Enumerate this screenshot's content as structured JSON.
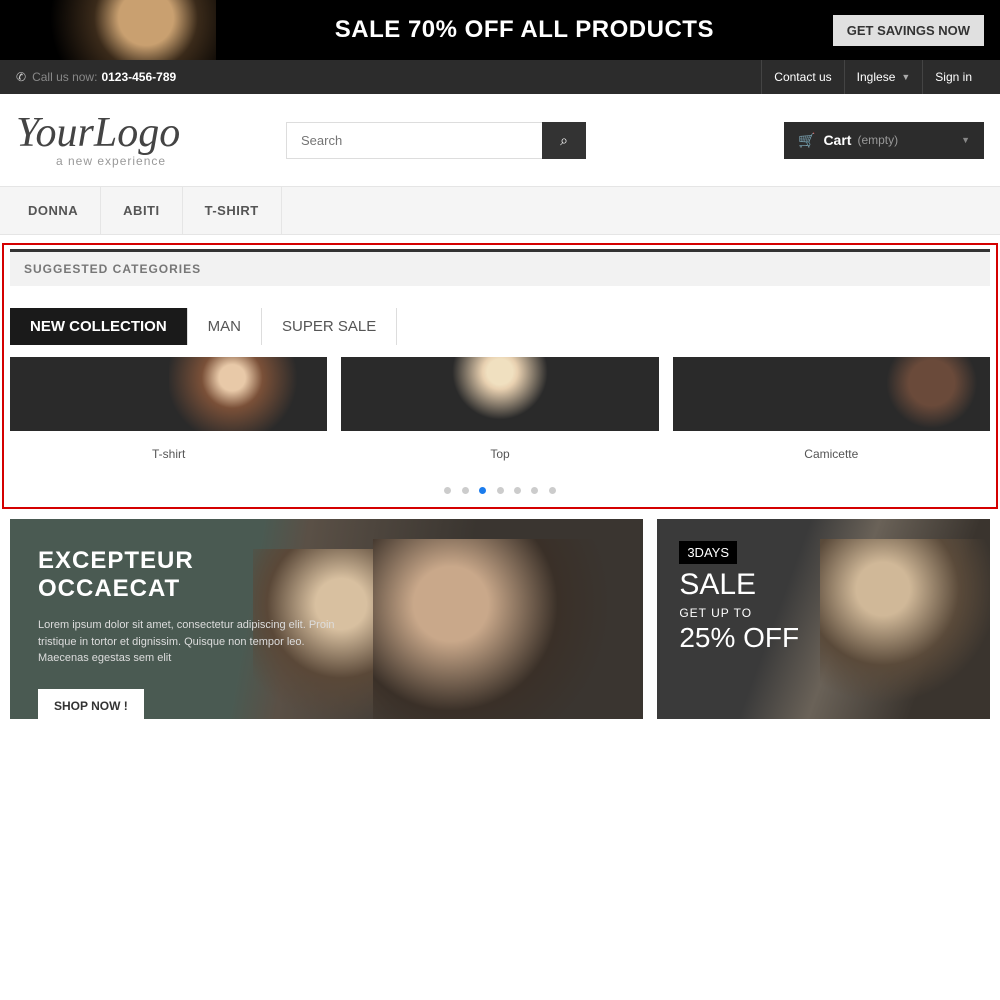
{
  "banner": {
    "headline": "SALE 70% OFF ALL PRODUCTS",
    "cta": "GET SAVINGS NOW"
  },
  "topnav": {
    "call_label": "Call us now:",
    "phone": "0123-456-789",
    "contact": "Contact us",
    "language": "Inglese",
    "signin": "Sign in"
  },
  "logo": {
    "main": "YourLogo",
    "sub": "a new experience"
  },
  "search": {
    "placeholder": "Search"
  },
  "cart": {
    "label": "Cart",
    "status": "(empty)"
  },
  "mainnav": {
    "items": [
      "DONNA",
      "ABITI",
      "T-SHIRT"
    ]
  },
  "suggested": {
    "title": "SUGGESTED CATEGORIES",
    "tabs": [
      "NEW COLLECTION",
      "MAN",
      "SUPER SALE"
    ],
    "active_tab": 0,
    "items": [
      {
        "label": "T-shirt"
      },
      {
        "label": "Top"
      },
      {
        "label": "Camicette"
      }
    ],
    "dot_count": 7,
    "active_dot": 2
  },
  "promo_left": {
    "title1": "EXCEPTEUR",
    "title2": "OCCAECAT",
    "text": "Lorem ipsum dolor sit amet, consectetur adipiscing elit. Proin tristique in tortor et dignissim. Quisque non tempor leo. Maecenas egestas sem elit",
    "cta": "SHOP NOW !"
  },
  "promo_right": {
    "badge": "3DAYS",
    "t1": "SALE",
    "t2": "GET UP TO",
    "t3": "25% OFF"
  }
}
